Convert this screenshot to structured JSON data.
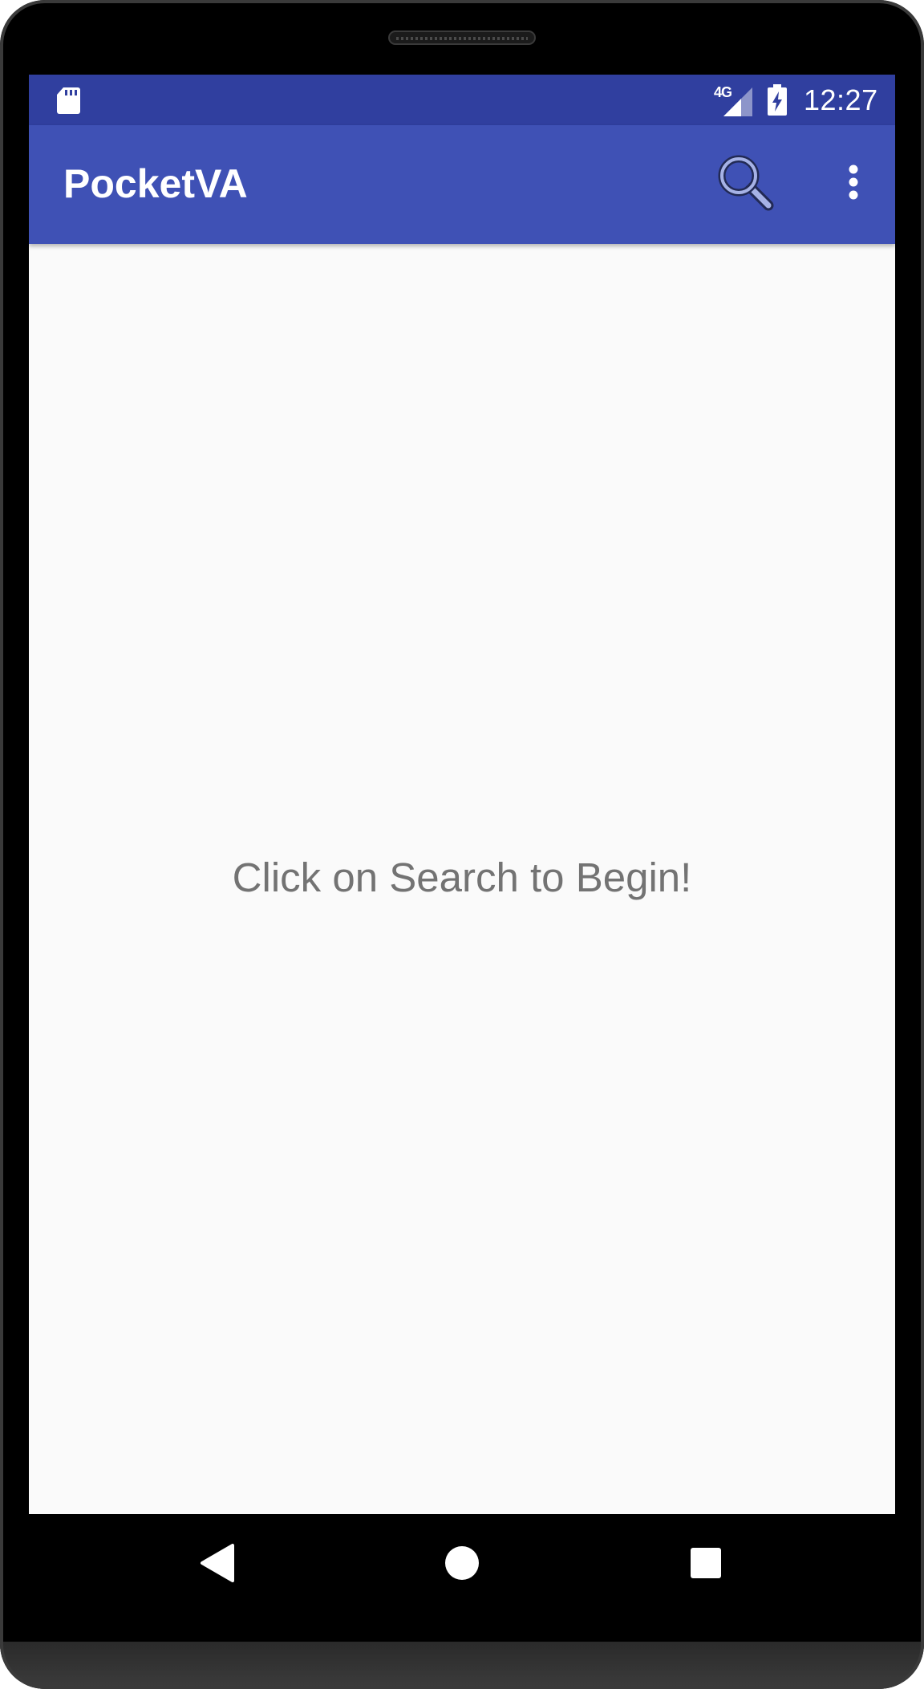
{
  "colors": {
    "status_bar": "#303f9f",
    "app_bar": "#3f51b5",
    "background": "#fafafa",
    "prompt_text": "#737373",
    "device_body": "#000000"
  },
  "status_bar": {
    "network_type": "4G",
    "time": "12:27",
    "icons": [
      "sd-card-icon",
      "signal-icon",
      "battery-charging-icon"
    ]
  },
  "app_bar": {
    "title": "PocketVA",
    "actions": [
      "search-icon",
      "more-vert-icon"
    ]
  },
  "main": {
    "prompt": "Click on Search to Begin!"
  },
  "nav_bar": {
    "buttons": [
      "back-icon",
      "home-icon",
      "recents-icon"
    ]
  }
}
